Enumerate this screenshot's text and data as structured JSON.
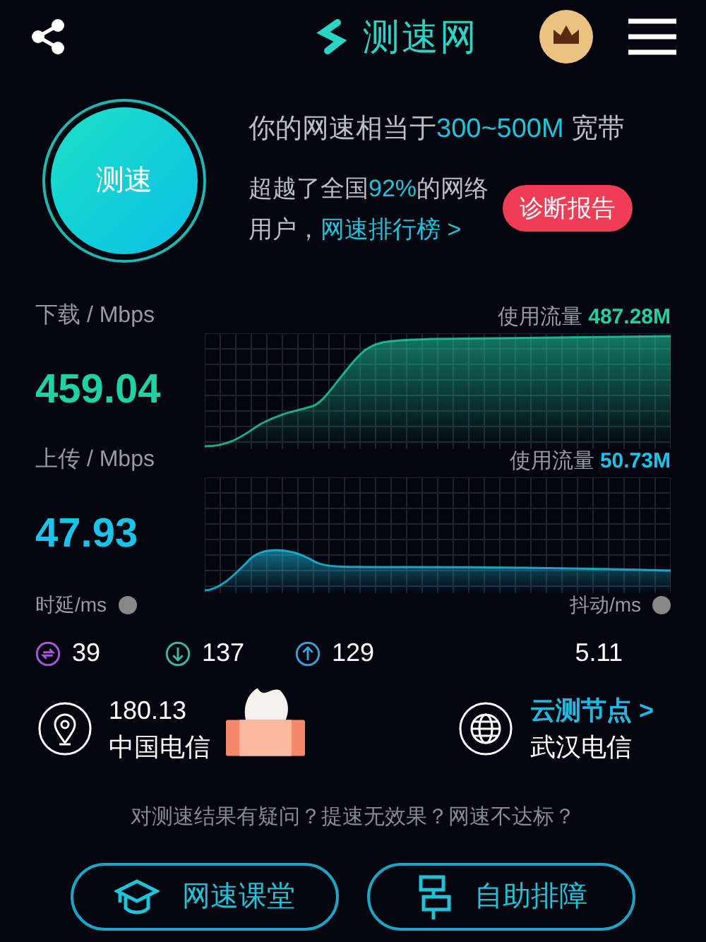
{
  "header": {
    "logo_text": "测速网"
  },
  "speed_button": {
    "label": "测速"
  },
  "summary": {
    "bandwidth_prefix": "你的网速相当于",
    "bandwidth": "300~500M",
    "bandwidth_suffix": "宽带",
    "rank_prefix": "超越了全国",
    "rank_percent": "92%",
    "rank_suffix": "的网络用户，",
    "rank_link": "网速排行榜 >",
    "report_button": "诊断报告"
  },
  "meters": [
    {
      "label": "下载 / Mbps",
      "value": "459.04",
      "usage_label": "使用流量",
      "usage": "487.28M",
      "color": "#1fd1a5",
      "kind": "download"
    },
    {
      "label": "上传 / Mbps",
      "value": "47.93",
      "usage_label": "使用流量",
      "usage": "50.73M",
      "color": "#1cc3e8",
      "kind": "upload"
    }
  ],
  "latency": {
    "label": "时延/ms",
    "items": [
      {
        "kind": "both",
        "value": "39",
        "color": "#a35ad6"
      },
      {
        "kind": "down",
        "value": "137",
        "color": "#3fb89a"
      },
      {
        "kind": "up",
        "value": "129",
        "color": "#3d9fd6"
      }
    ]
  },
  "jitter": {
    "label": "抖动/ms",
    "value": "5.11"
  },
  "client": {
    "ip": "180.13",
    "isp": "中国电信"
  },
  "server": {
    "link": "云测节点 >",
    "name": "武汉电信"
  },
  "question": "对测速结果有疑问？提速无效果？网速不达标？",
  "actions": [
    {
      "kind": "class",
      "label": "网速课堂"
    },
    {
      "kind": "troubleshoot",
      "label": "自助排障"
    }
  ]
}
